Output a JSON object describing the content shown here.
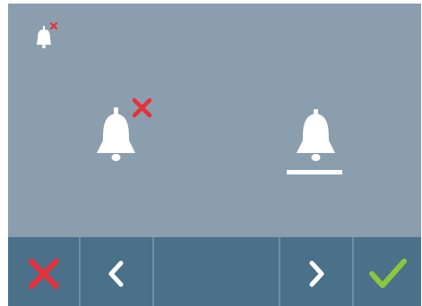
{
  "screen": {
    "title": "",
    "status_icon": "bell-muted-icon",
    "options": [
      {
        "icon": "bell-muted-icon",
        "selected": false
      },
      {
        "icon": "bell-icon",
        "selected": true
      }
    ]
  },
  "toolbar": {
    "buttons": [
      {
        "icon": "close-icon",
        "color": "#e8303a"
      },
      {
        "icon": "chevron-left-icon",
        "color": "#ffffff"
      },
      {
        "icon": "blank",
        "color": ""
      },
      {
        "icon": "chevron-right-icon",
        "color": "#ffffff"
      },
      {
        "icon": "checkmark-icon",
        "color": "#8cc63f"
      }
    ]
  },
  "colors": {
    "screen_bg": "#8b9eae",
    "toolbar_bg": "#4a7189",
    "bell": "#ffffff",
    "cross": "#e8303a",
    "check": "#8cc63f"
  }
}
